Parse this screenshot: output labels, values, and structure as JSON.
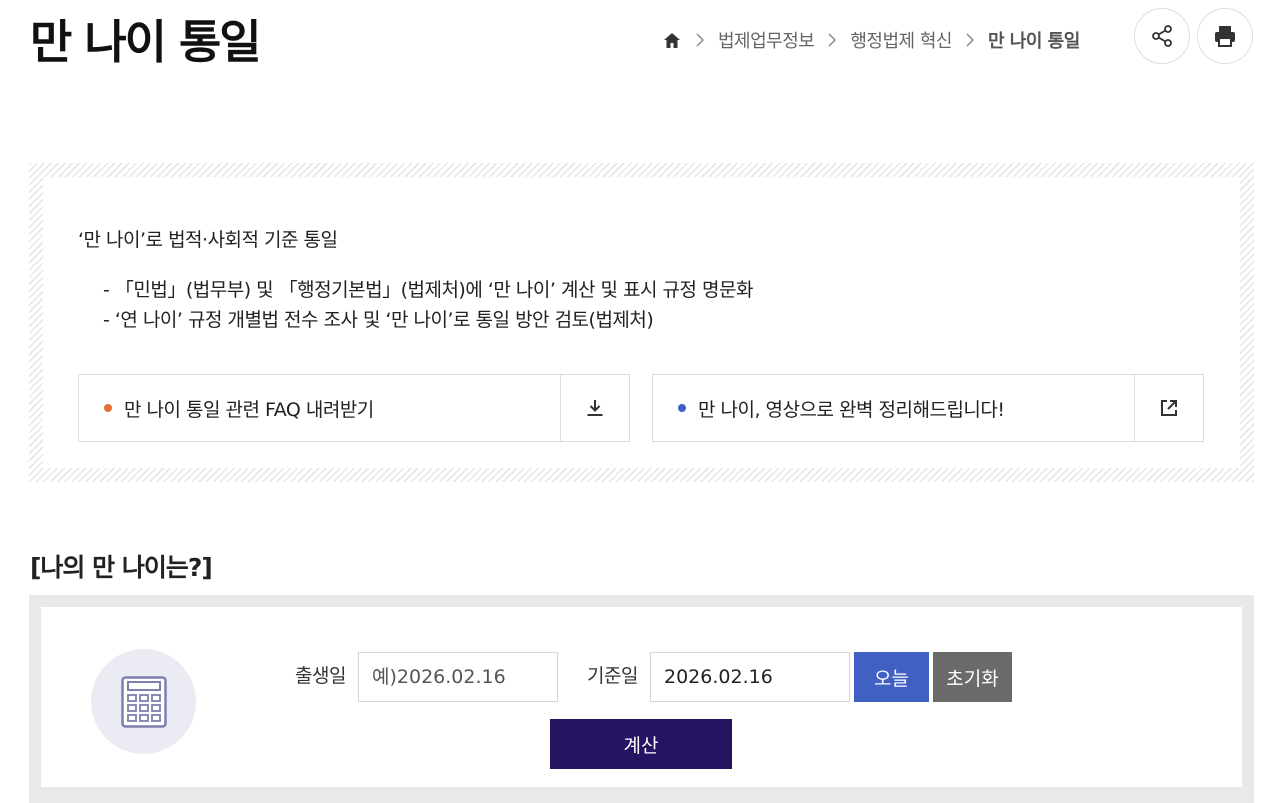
{
  "page": {
    "title": "만 나이 통일"
  },
  "breadcrumb": {
    "items": [
      "법제업무정보",
      "행정법제 혁신",
      "만 나이 통일"
    ]
  },
  "toolbar": {
    "share_icon": "share-icon",
    "print_icon": "print-icon"
  },
  "info": {
    "heading": "‘만 나이’로 법적·사회적 기준 통일",
    "items": [
      "- 「민법」(법무부) 및 「행정기본법」(법제처)에 ‘만 나이’ 계산 및 표시 규정 명문화",
      "- ‘연 나이’ 규정 개별법 전수 조사 및 ‘만 나이’로 통일 방안 검토(법제처)"
    ],
    "links": [
      {
        "label": "만 나이 통일 관련 FAQ 내려받기",
        "dot_color": "#e0703a",
        "icon": "download-icon"
      },
      {
        "label": "만 나이, 영상으로 완벽 정리해드립니다!",
        "dot_color": "#3f5fc2",
        "icon": "external-link-icon"
      }
    ]
  },
  "calculator": {
    "section_title": "[나의 만 나이는?]",
    "icon": "calculator-icon",
    "birth_label": "출생일",
    "birth_placeholder": "예)2026.02.16",
    "base_label": "기준일",
    "base_value": "2026.02.16",
    "today_button": "오늘",
    "reset_button": "초기화",
    "calc_button": "계산"
  },
  "colors": {
    "today": "#4160c4",
    "reset": "#6a6a6a",
    "calc": "#241462"
  }
}
